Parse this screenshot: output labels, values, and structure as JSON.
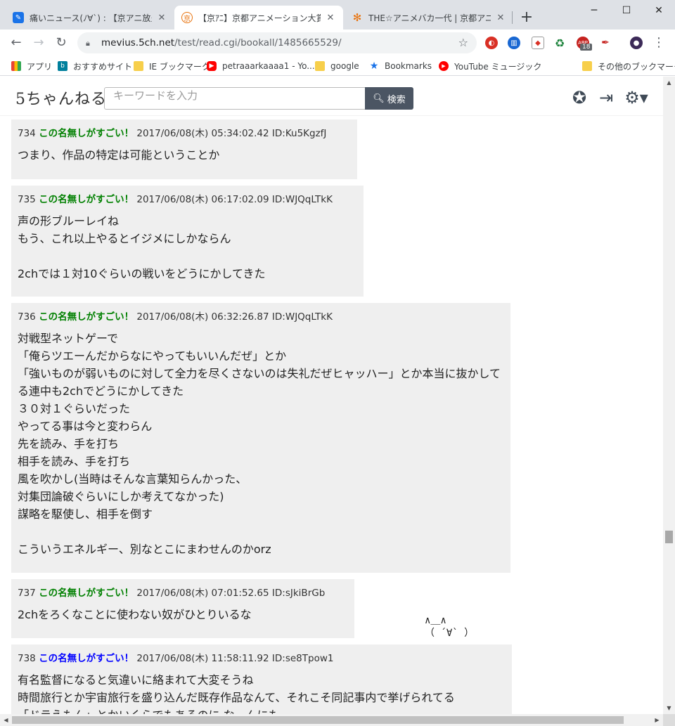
{
  "tabs": [
    {
      "title": "痛いニュース(ﾉ∀`) : 【京アニ放火】 著",
      "icon": "pen-icon",
      "color": "#1a73e8"
    },
    {
      "title": "【京ｱﾆ】京都アニメーション大賞【KAIX",
      "icon": "kyoani-icon",
      "color": "#e8710a"
    },
    {
      "title": "THE☆アニメバカ一代 | 京都アニメーシ",
      "icon": "sparkle-icon",
      "color": "#e8710a"
    }
  ],
  "window_controls": {
    "minimize": "─",
    "maximize": "☐",
    "close": "✕"
  },
  "newtab_label": "+",
  "nav": {
    "back": "←",
    "forward": "→",
    "reload": "↻",
    "menu": "⋮"
  },
  "address": {
    "host": "mevius.5ch.net",
    "path": "/test/read.cgi/bookall/1485665529/"
  },
  "extensions_badge": "18",
  "bookmarks": [
    {
      "label": "アプリ",
      "icon": "apps-grid-icon"
    },
    {
      "label": "おすすめサイト",
      "icon": "bing-icon"
    },
    {
      "label": "IE ブックマーク",
      "icon": "folder-icon"
    },
    {
      "label": "petraaarkaaaa1 - Yo...",
      "icon": "youtube-icon"
    },
    {
      "label": "google",
      "icon": "folder-icon"
    },
    {
      "label": "Bookmarks",
      "icon": "star-icon"
    },
    {
      "label": "YouTube ミュージック",
      "icon": "youtube-music-icon"
    },
    {
      "label": "その他のブックマーク",
      "icon": "folder-icon"
    }
  ],
  "site": {
    "logo": "5ちゃんねる",
    "search_placeholder": "キーワードを入力",
    "search_button": "検索"
  },
  "posts": [
    {
      "num": "734",
      "name": "この名無しがすごい！",
      "name_color": "green",
      "date": "2017/06/08(木) 05:34:02.42",
      "id": "ID:Ku5KgzfJ",
      "body": "つまり、作品の特定は可能ということか"
    },
    {
      "num": "735",
      "name": "この名無しがすごい！",
      "name_color": "green",
      "date": "2017/06/08(木) 06:17:02.09",
      "id": "ID:WJQqLTkK",
      "body": "声の形ブルーレイね\nもう、これ以上やるとイジメにしかならん\n\n2chでは１対10ぐらいの戦いをどうにかしてきた"
    },
    {
      "num": "736",
      "name": "この名無しがすごい！",
      "name_color": "green",
      "date": "2017/06/08(木) 06:32:26.87",
      "id": "ID:WJQqLTkK",
      "body": "対戦型ネットゲーで\n「俺らツエーんだからなにやってもいいんだぜ」とか\n「強いものが弱いものに対して全力を尽くさないのは失礼だぜヒャッハー」とか本当に抜かしてる連中も2chでどうにかしてきた\n３０対１ぐらいだった\nやってる事は今と変わらん\n先を読み、手を打ち\n相手を読み、手を打ち\n風を吹かし(当時はそんな言葉知らんかった、\n対集団論破ぐらいにしか考えてなかった)\n謀略を駆使し、相手を倒す\n\nこういうエネルギー、別なとこにまわせんのかorz"
    },
    {
      "num": "737",
      "name": "この名無しがすごい！",
      "name_color": "green",
      "date": "2017/06/08(木) 07:01:52.65",
      "id": "ID:sJkiBrGb",
      "body": "2chをろくなことに使わない奴がひとりいるな"
    },
    {
      "num": "738",
      "name": "この名無しがすごい！",
      "name_color": "blue",
      "date": "2017/06/08(木) 11:58:11.92",
      "id": "ID:se8Tpow1",
      "body": "有名監督になると気違いに絡まれて大変そうね\n時間旅行とか宇宙旅行を盛り込んだ既存作品なんて、それこそ同記事内で挙げられてる\n「ドラえもん」とかいくらでもあるのに なーんにも"
    }
  ],
  "ascii_art": "∧＿∧\n（ ´∀` ）"
}
